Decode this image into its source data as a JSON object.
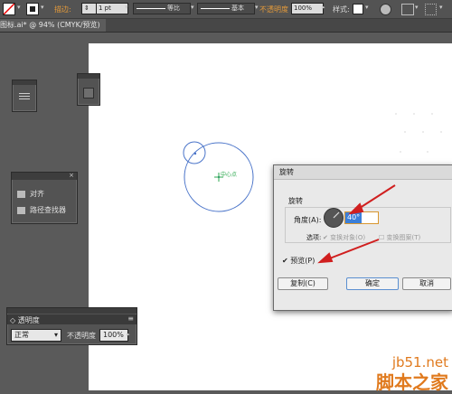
{
  "control_bar": {
    "stroke_label": "描边:",
    "stroke_value": "1 pt",
    "profile1_label": "等比",
    "profile2_label": "基本",
    "opacity_label": "不透明度",
    "opacity_value": "100%",
    "style_label": "样式:"
  },
  "document_tab": {
    "title": "图标.ai* @ 94% (CMYK/预览)"
  },
  "panels": {
    "align": {
      "items": [
        "对齐",
        "路径查找器"
      ]
    },
    "transparency": {
      "title": "透明度",
      "blend_mode": "正常",
      "opacity_label": "不透明度",
      "opacity_value": "100%"
    }
  },
  "canvas": {
    "center_label": "中心点"
  },
  "rotate_dialog": {
    "title": "旋转",
    "section_label": "旋转",
    "angle_label": "角度(A):",
    "angle_value": "40°",
    "options_label": "选项:",
    "opt_transform_objects": "变换对象(O)",
    "opt_transform_patterns": "变换图案(T)",
    "preview_label": "预览(P)",
    "copy_button": "复制(C)",
    "ok_button": "确定",
    "cancel_button": "取消"
  },
  "watermark": {
    "url": "jb51.net",
    "name": "脚本之家"
  },
  "colors": {
    "accent_orange": "#e49a3a",
    "dialog_blue": "#3b7fd9",
    "arrow_red": "#d01f1f",
    "shape_blue": "#4a74c9"
  }
}
